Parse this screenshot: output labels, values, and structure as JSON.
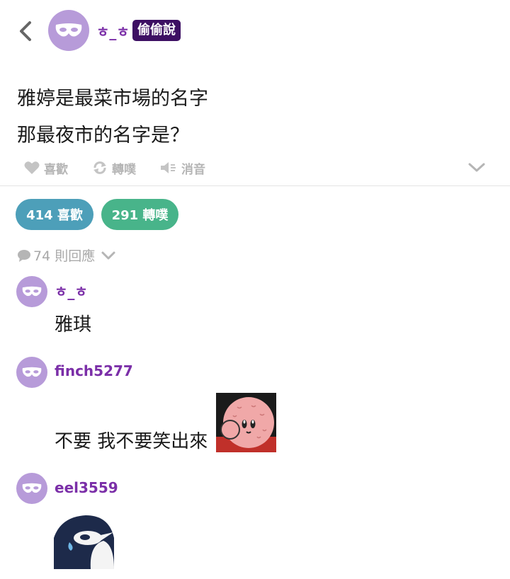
{
  "header": {
    "username": "ㅎ_ㅎ",
    "tag": "偷偷說"
  },
  "post": {
    "line1": "雅婷是最菜市場的名字",
    "line2": "那最夜市的名字是？"
  },
  "actions": {
    "like": "喜歡",
    "share": "轉噗",
    "mute": "消音"
  },
  "stats": {
    "likes": "414 喜歡",
    "shares": "291 轉噗"
  },
  "replies": {
    "count_label": "74 則回應"
  },
  "comments": [
    {
      "username": "ㅎ_ㅎ",
      "text": "雅琪"
    },
    {
      "username": "finch5277",
      "text": "不要 我不要笑出來"
    },
    {
      "username": "eel3559",
      "text": ""
    }
  ],
  "colors": {
    "username": "#7b2fa8",
    "tag_bg": "#3d0f63",
    "avatar_bg": "#b79bd9",
    "likes_pill": "#4d9fb9",
    "shares_pill": "#48b48a"
  },
  "icons": [
    "back-arrow-icon",
    "mask-icon",
    "heart-icon",
    "replurk-icon",
    "mute-icon",
    "chevron-down-icon",
    "speech-bubble-icon"
  ]
}
